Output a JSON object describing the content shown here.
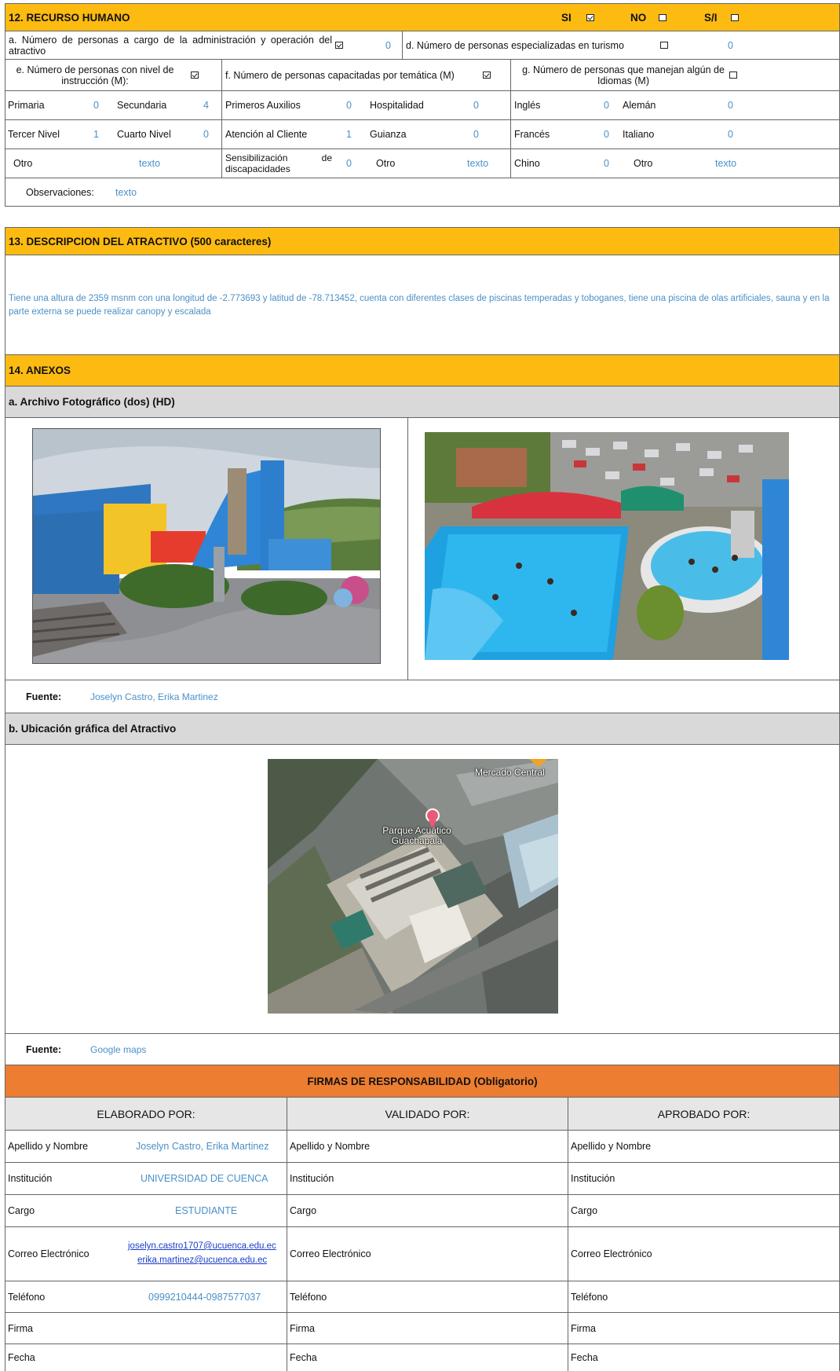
{
  "s12": {
    "title": "12. RECURSO HUMANO",
    "si": "SI",
    "no": "NO",
    "sn": "S/I",
    "a_label": "a. Número de personas a cargo de la administración y operación del atractivo",
    "a_value": "0",
    "d_label": "d. Número de personas especializadas en turismo",
    "d_value": "0",
    "e_label": "e. Número de personas con nivel de instrucción (M):",
    "f_label": "f. Número de personas capacitadas por temática (M)",
    "g_label": "g. Número de personas que manejan algún de Idiomas (M)",
    "rows": [
      {
        "e1": "Primaria",
        "e1v": "0",
        "e2": "Secundaria",
        "e2v": "4",
        "f1": "Primeros Auxilios",
        "f1v": "0",
        "f2": "Hospitalidad",
        "f2v": "0",
        "g1": "Inglés",
        "g1v": "0",
        "g2": "Alemán",
        "g2v": "0"
      },
      {
        "e1": "Tercer Nivel",
        "e1v": "1",
        "e2": "Cuarto Nivel",
        "e2v": "0",
        "f1": "Atención al Cliente",
        "f1v": "1",
        "f2": "Guianza",
        "f2v": "0",
        "g1": "Francés",
        "g1v": "0",
        "g2": "Italiano",
        "g2v": "0"
      },
      {
        "e1": "Otro",
        "e1v": "texto",
        "f1": "Sensibilización de discapacidades",
        "f1v": "0",
        "f2": "Otro",
        "f2v": "texto",
        "g1": "Chino",
        "g1v": "0",
        "g2": "Otro",
        "g2v": "texto"
      }
    ],
    "obs_label": "Observaciones:",
    "obs_value": "texto"
  },
  "s13": {
    "title": "13. DESCRIPCION DEL ATRACTIVO (500 caracteres)",
    "text": "Tiene una altura de 2359 msnm con una longitud de -2.773693 y latitud de -78.713452, cuenta con diferentes clases de piscinas temperadas y toboganes, tiene una piscina de olas artificiales, sauna y en la parte externa se puede realizar canopy y escalada"
  },
  "s14": {
    "title": "14. ANEXOS",
    "a_title": "a. Archivo Fotográfico (dos) (HD)",
    "fuente_label": "Fuente:",
    "fuente_a": "Joselyn Castro, Erika Martinez",
    "b_title": "b. Ubicación gráfica del Atractivo",
    "map_label_1": "Mercado Central",
    "map_label_2": "Parque Acuático Guachapala",
    "fuente_b": "Google maps"
  },
  "firmas": {
    "title": "FIRMAS DE RESPONSABILIDAD (Obligatorio)",
    "cols": [
      "ELABORADO POR:",
      "VALIDADO POR:",
      "APROBADO POR:"
    ],
    "labels": [
      "Apellido y Nombre",
      "Institución",
      "Cargo",
      "Correo Electrónico",
      "Teléfono",
      "Firma",
      "Fecha"
    ],
    "values": {
      "nombre": "Joselyn Castro, Erika Martinez",
      "institucion": "UNIVERSIDAD DE CUENCA",
      "cargo": "ESTUDIANTE",
      "correo1": "joselyn.castro1707@ucuenca.edu.ec",
      "correo2": "erika.martinez@ucuenca.edu.ec",
      "telefono": "0999210444-0987577037"
    }
  },
  "colors": {
    "gold": "#fdbb11",
    "orange": "#ed7d31",
    "grey": "#d9d9d9",
    "value_blue": "#4a90c8"
  }
}
